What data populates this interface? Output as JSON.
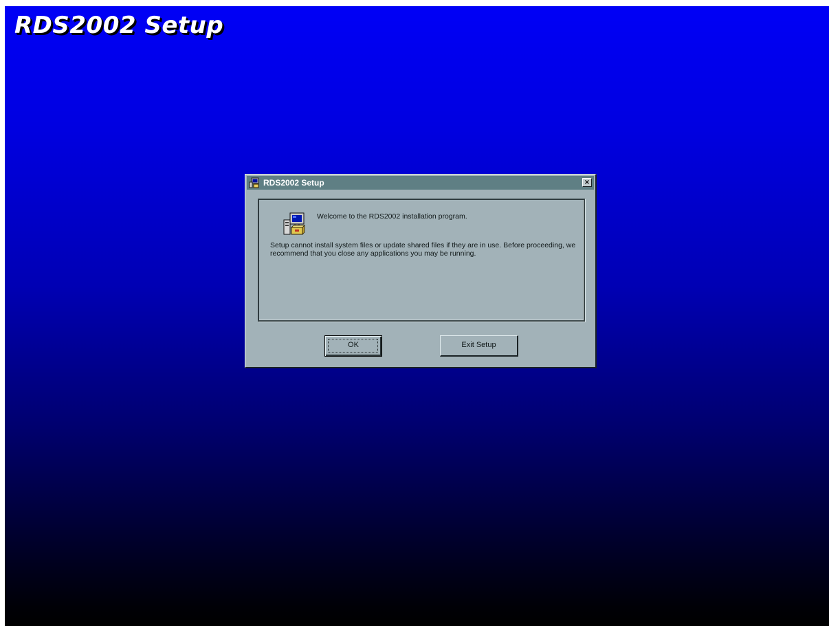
{
  "background": {
    "banner_title": "RDS2002 Setup",
    "gradient_top": "#0000f6",
    "gradient_bottom": "#000000"
  },
  "dialog": {
    "title": "RDS2002 Setup",
    "title_icon": "setup-computer-icon",
    "close_glyph": "×",
    "titlebar_color": "#5f7f84",
    "face_color": "#a2b2b8",
    "main_icon": "setup-computer-icon",
    "welcome_text": "Welcome to the RDS2002 installation program.",
    "warning_text": "Setup cannot install system files or update shared files if they are in use. Before proceeding, we recommend that you close any applications you may be running.",
    "buttons": {
      "ok_label": "OK",
      "exit_label": "Exit Setup"
    }
  }
}
